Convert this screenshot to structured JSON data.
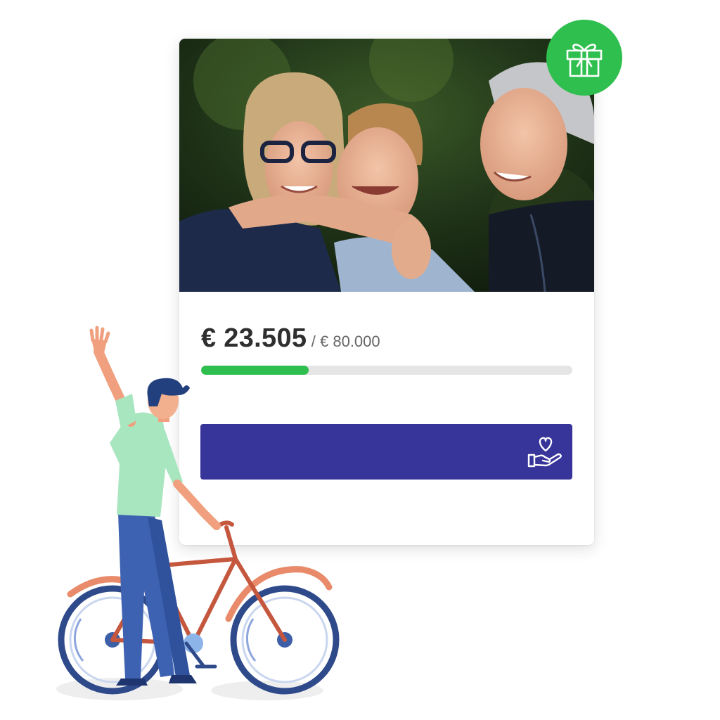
{
  "campaign": {
    "raised": "€ 23.505",
    "goal": "/ € 80.000",
    "progress_fraction": 0.29,
    "donate_label": ""
  },
  "colors": {
    "accent_green": "#2fbf4e",
    "button_indigo": "#37349a",
    "progress_track": "#e5e5e5"
  },
  "icons": {
    "badge": "gift-icon",
    "donate": "heart-in-hand-icon"
  }
}
